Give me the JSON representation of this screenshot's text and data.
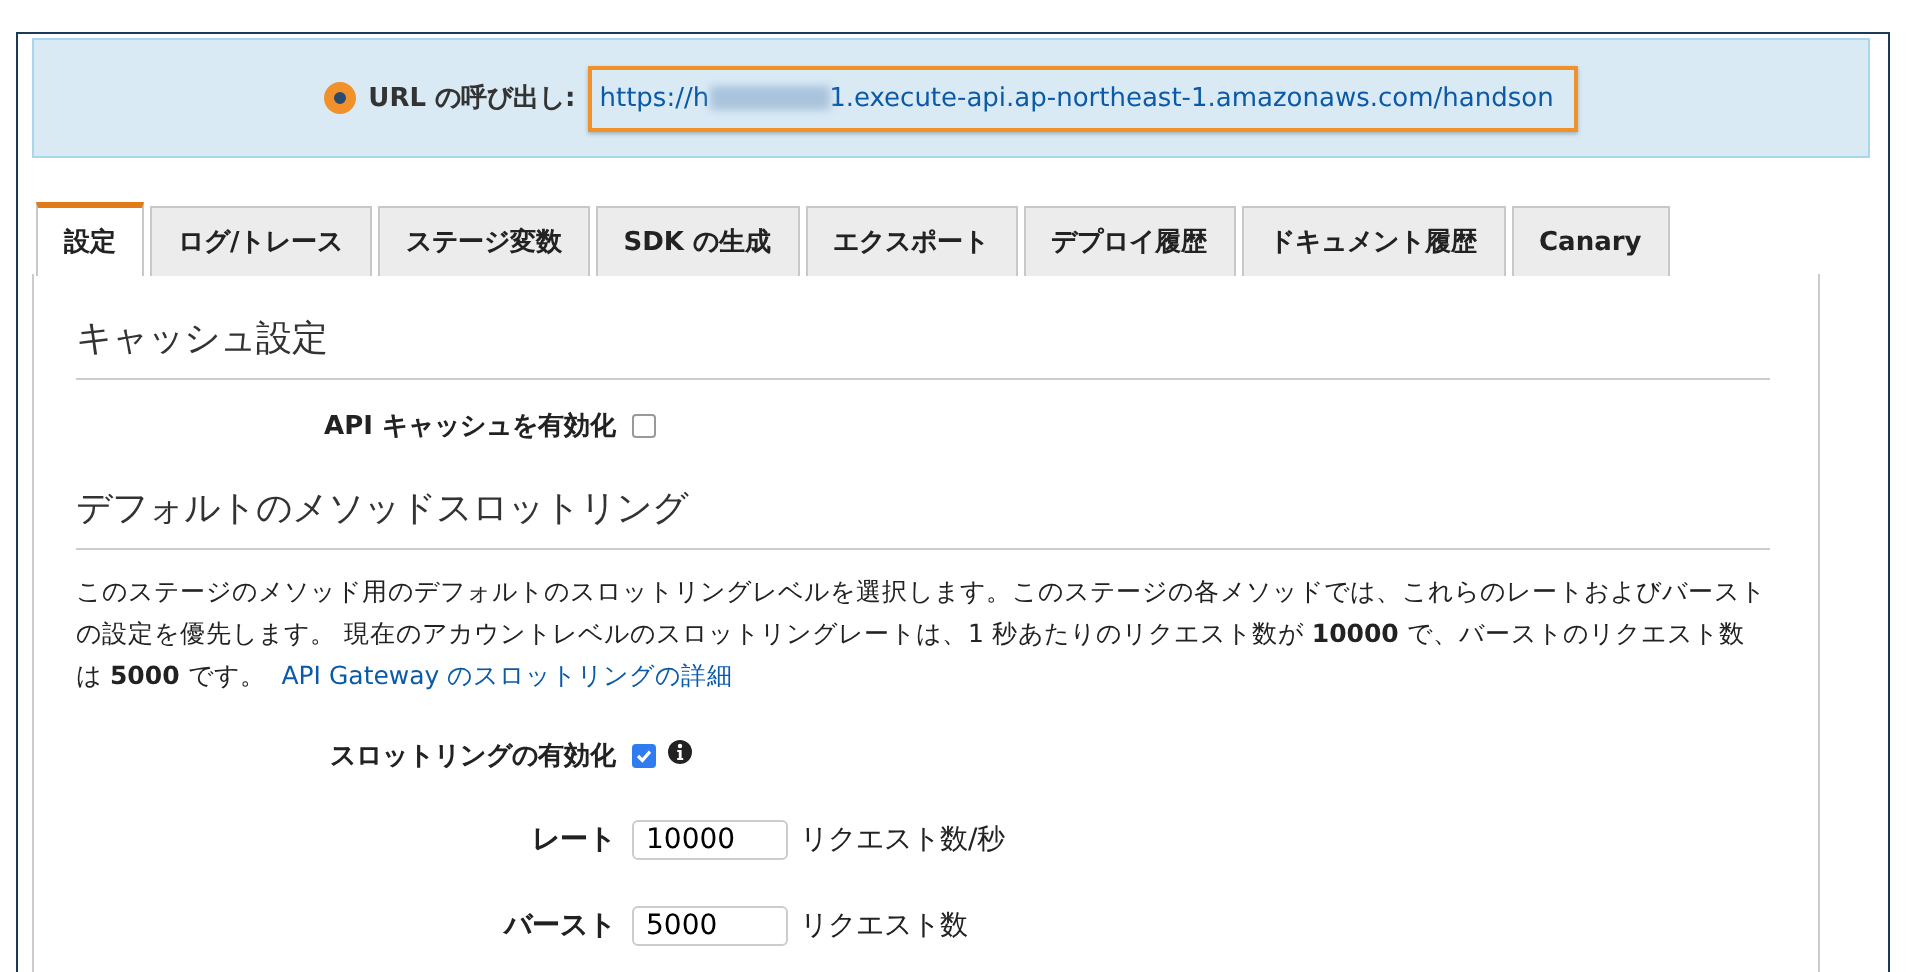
{
  "invoke_url": {
    "label": "URL の呼び出し:",
    "url_start": "https://h",
    "url_end": "1.execute-api.ap-northeast-1.amazonaws.com/handson"
  },
  "tabs": [
    {
      "label": "設定",
      "selected": true
    },
    {
      "label": "ログ/トレース",
      "selected": false
    },
    {
      "label": "ステージ変数",
      "selected": false
    },
    {
      "label": "SDK の生成",
      "selected": false
    },
    {
      "label": "エクスポート",
      "selected": false
    },
    {
      "label": "デプロイ履歴",
      "selected": false
    },
    {
      "label": "ドキュメント履歴",
      "selected": false
    },
    {
      "label": "Canary",
      "selected": false
    }
  ],
  "cache": {
    "heading": "キャッシュ設定",
    "label": "API キャッシュを有効化",
    "checked": false
  },
  "throttling": {
    "heading": "デフォルトのメソッドスロットリング",
    "description": "このステージのメソッド用のデフォルトのスロットリングレベルを選択します。このステージの各メソッドでは、これらのレートおよびバーストの設定を優先します。 現在のアカウントレベルのスロットリングレートは、1 秒あたりのリクエスト数が **10000** で、バーストのリクエスト数は **5000** です。",
    "link": "API Gateway のスロットリングの詳細",
    "enable_label": "スロットリングの有効化",
    "enabled": true,
    "fields": [
      {
        "label": "レート",
        "value": "10000",
        "unit": "リクエスト数/秒"
      },
      {
        "label": "バースト",
        "value": "5000",
        "unit": "リクエスト数"
      }
    ]
  }
}
